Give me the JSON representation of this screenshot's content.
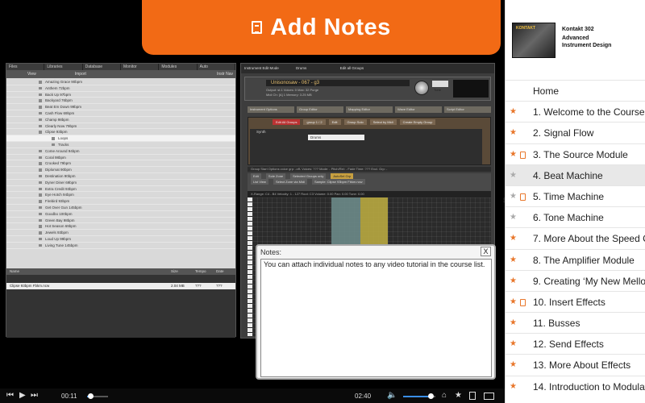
{
  "banner": {
    "title": "Add Notes"
  },
  "daw": {
    "tabs": [
      "Files",
      "Libraries",
      "Database",
      "Monitor",
      "Modules",
      "Auto"
    ],
    "toolbar": {
      "view": "View",
      "import": "Import",
      "right": "Instr Nav"
    },
    "files": [
      {
        "name": "Amazing Grace 90bpm",
        "sub": false
      },
      {
        "name": "Anthem 72bpm",
        "sub": false
      },
      {
        "name": "Back Up 97bpm",
        "sub": false
      },
      {
        "name": "Backyard 76bpm",
        "sub": false
      },
      {
        "name": "Beat Em Down 99bpm",
        "sub": false
      },
      {
        "name": "Cash Flow 69bpm",
        "sub": false
      },
      {
        "name": "Champ 98bpm",
        "sub": false
      },
      {
        "name": "Clearly Now 79bpm",
        "sub": false
      },
      {
        "name": "Clipse 93bpm",
        "sub": false
      },
      {
        "name": "Loops",
        "sub": true,
        "selected": true
      },
      {
        "name": "Tracks",
        "sub": true
      },
      {
        "name": "Come Around 94bpm",
        "sub": false
      },
      {
        "name": "Coral 98bpm",
        "sub": false
      },
      {
        "name": "Crooked 79bpm",
        "sub": false
      },
      {
        "name": "Diplomat 90bpm",
        "sub": false
      },
      {
        "name": "Destination 90bpm",
        "sub": false
      },
      {
        "name": "Dyner Diner 69bpm",
        "sub": false
      },
      {
        "name": "Extra Credit 93bpm",
        "sub": false
      },
      {
        "name": "Eye Hotch 94bpm",
        "sub": false
      },
      {
        "name": "Firebird 93bpm",
        "sub": false
      },
      {
        "name": "Get Over Gun 145bpm",
        "sub": false
      },
      {
        "name": "Goodbo 100bpm",
        "sub": false
      },
      {
        "name": "Green Bay 98bpm",
        "sub": false
      },
      {
        "name": "Hot Season 69bpm",
        "sub": false
      },
      {
        "name": "Jewels 93bpm",
        "sub": false
      },
      {
        "name": "Loud Up 99bpm",
        "sub": false
      },
      {
        "name": "Living Tune 145bpm",
        "sub": false
      }
    ],
    "lower_headers": [
      "Name",
      "Size",
      "Tempo",
      "Date"
    ],
    "lower_row": {
      "name": "Clipse 93bpm Fbkm.ncw",
      "size": "2.04 MB",
      "tempo": "???",
      "date": "???"
    }
  },
  "kontakt": {
    "top": "Instrument Edit Mode",
    "group": "Drums",
    "edit_all": "Edit all Groups",
    "instrument_name": "Unisonosaw - 067 - g3",
    "meta1": "Output: st.1   Voices: 0   Max: 32   Purge",
    "meta2": "Midi Ch: [A] 1   Memory: 3.25 MB",
    "tune_label": "Tune",
    "tune_value": "0.00",
    "editor_tabs": [
      "Instrument Options",
      "Group Editor",
      "Mapping Editor",
      "Wave Editor",
      "Script Editor"
    ],
    "group_buttons": [
      "Edit All Groups",
      "group 1 / 2",
      "Edit",
      "Group Solo",
      "Select by Midi",
      "Create Empty Group"
    ],
    "group_list": [
      "Synth",
      "Drums"
    ],
    "group_start": "Group Start Options   voice grp: -off-   Voices: ???   Mode: -   Pitch/Rel: -   Fade Time: ???   Excl. Grp: -",
    "mapping_line1": [
      "Edit",
      "Sole Zone",
      "Selected Groups only",
      "AutoSel Grp"
    ],
    "mapping_line2": [
      "List View",
      "Select Zone via Midi",
      "Sample: Clipse 93bpm Fbkm.ncw"
    ],
    "keyrange": "X-Range: C4 - B4   Velocity: 1 - 127   Root: C3   Volume: 0.00   Pan: 0.00   Tune: 0.00"
  },
  "notes": {
    "title": "Notes:",
    "close": "X",
    "text": "You can attach individual notes to any video tutorial in the course list."
  },
  "player": {
    "elapsed": "00:11",
    "remaining": "02:40",
    "progress": 0.16,
    "volume": 0.85
  },
  "sidebar": {
    "product_line": "Kontakt 302",
    "product_title1": "Advanced",
    "product_title2": "Instrument Design",
    "cover_label": "KONTAKT",
    "home": "Home",
    "items": [
      {
        "label": "1. Welcome to the Course",
        "star": "orange",
        "note": false,
        "active": false
      },
      {
        "label": "2. Signal Flow",
        "star": "orange",
        "note": false,
        "active": false
      },
      {
        "label": "3. The Source Module",
        "star": "orange",
        "note": true,
        "active": false
      },
      {
        "label": "4. Beat Machine",
        "star": "gray",
        "note": false,
        "active": true
      },
      {
        "label": "5. Time Machine",
        "star": "gray",
        "note": true,
        "active": false
      },
      {
        "label": "6. Tone Machine",
        "star": "gray",
        "note": false,
        "active": false
      },
      {
        "label": "7. More About the Speed C",
        "star": "orange",
        "note": false,
        "active": false
      },
      {
        "label": "8. The Amplifier Module",
        "star": "orange",
        "note": false,
        "active": false
      },
      {
        "label": "9. Creating ‘My New Mellot",
        "star": "orange",
        "note": false,
        "active": false
      },
      {
        "label": "10. Insert Effects",
        "star": "orange",
        "note": true,
        "active": false
      },
      {
        "label": "11. Busses",
        "star": "orange",
        "note": false,
        "active": false
      },
      {
        "label": "12. Send Effects",
        "star": "orange",
        "note": false,
        "active": false
      },
      {
        "label": "13. More About Effects",
        "star": "orange",
        "note": false,
        "active": false
      },
      {
        "label": "14. Introduction to Modulat",
        "star": "orange",
        "note": false,
        "active": false
      }
    ]
  }
}
